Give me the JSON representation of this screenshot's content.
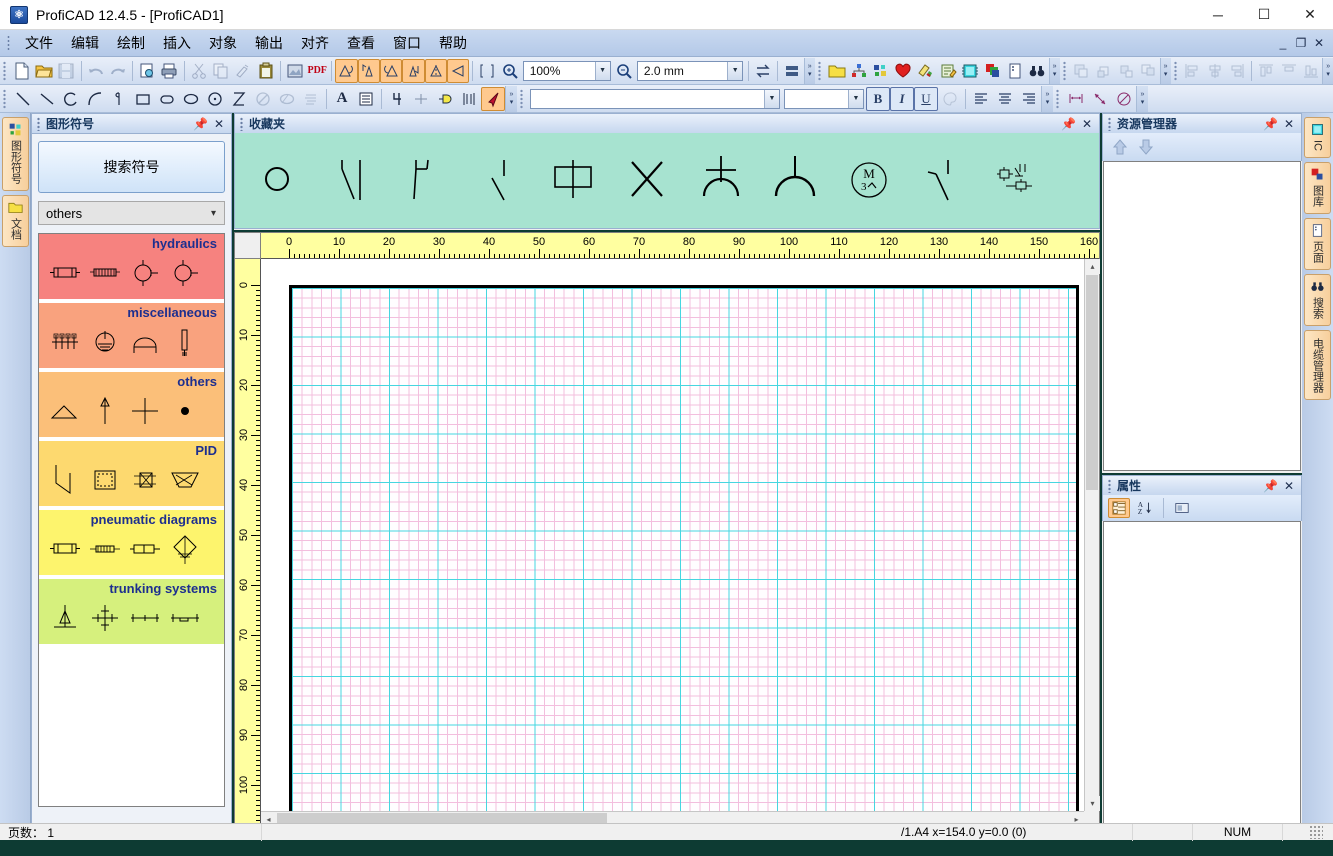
{
  "window": {
    "title": "ProfiCAD 12.4.5 - [ProfiCAD1]",
    "app_icon": "proficad-logo-icon",
    "minimize": "─",
    "maximize": "☐",
    "close": "✕",
    "mdi_minimize": "_",
    "mdi_restore": "❐",
    "mdi_close": "✕"
  },
  "menu": {
    "items": [
      {
        "label": "文件"
      },
      {
        "label": "编辑"
      },
      {
        "label": "绘制"
      },
      {
        "label": "插入"
      },
      {
        "label": "对象"
      },
      {
        "label": "输出"
      },
      {
        "label": "对齐"
      },
      {
        "label": "查看"
      },
      {
        "label": "窗口"
      },
      {
        "label": "帮助"
      }
    ]
  },
  "toolbar_main": {
    "zoom_value": "100%",
    "grid_value": "2.0 mm",
    "pdf_label": "PDF",
    "buttons": [
      {
        "name": "new-file-button",
        "icon": "new-document-icon"
      },
      {
        "name": "open-file-button",
        "icon": "open-folder-icon"
      },
      {
        "name": "save-file-button",
        "icon": "save-disk-icon",
        "disabled": true
      },
      {
        "name": "undo-button",
        "icon": "undo-arrow-icon",
        "disabled": true
      },
      {
        "name": "redo-button",
        "icon": "redo-arrow-icon",
        "disabled": true
      },
      {
        "name": "print-preview-button",
        "icon": "print-preview-icon"
      },
      {
        "name": "print-button",
        "icon": "printer-icon"
      },
      {
        "name": "cut-button",
        "icon": "scissors-icon",
        "disabled": true
      },
      {
        "name": "copy-button",
        "icon": "copy-pages-icon",
        "disabled": true
      },
      {
        "name": "format-painter-button",
        "icon": "brush-icon",
        "disabled": true
      },
      {
        "name": "paste-button",
        "icon": "clipboard-icon"
      },
      {
        "name": "export-image-button",
        "icon": "export-image-icon"
      },
      {
        "name": "export-pdf-button",
        "icon": "pdf-icon"
      },
      {
        "name": "rotate-left-button",
        "icon": "rotate-left-icon"
      },
      {
        "name": "rotate-up-button",
        "icon": "rotate-up-icon"
      },
      {
        "name": "rotate-right-button",
        "icon": "rotate-right-icon"
      },
      {
        "name": "rotate-down-button",
        "icon": "rotate-down-icon"
      },
      {
        "name": "mirror-horizontal-button",
        "icon": "mirror-horizontal-icon"
      },
      {
        "name": "mirror-vertical-button",
        "icon": "mirror-vertical-icon"
      },
      {
        "name": "fit-page-button",
        "icon": "fit-page-icon"
      },
      {
        "name": "zoom-in-button",
        "icon": "magnifier-plus-icon"
      },
      {
        "name": "zoom-out-button",
        "icon": "magnifier-minus-icon"
      },
      {
        "name": "swap-button",
        "icon": "swap-arrows-icon"
      },
      {
        "name": "split-view-button",
        "icon": "split-view-icon"
      }
    ],
    "right_buttons": [
      {
        "name": "library-button",
        "icon": "yellow-folder-icon"
      },
      {
        "name": "hierarchy-button",
        "icon": "network-nodes-icon"
      },
      {
        "name": "netlist-button",
        "icon": "netlist-icon"
      },
      {
        "name": "favorites-button",
        "icon": "red-heart-icon"
      },
      {
        "name": "colors-button",
        "icon": "paint-layers-icon"
      },
      {
        "name": "notes-button",
        "icon": "note-pencil-icon"
      },
      {
        "name": "ic-button",
        "icon": "ic-chip-icon"
      },
      {
        "name": "layers-button",
        "icon": "layers-icon"
      },
      {
        "name": "page-button",
        "icon": "page-icon"
      },
      {
        "name": "find-button",
        "icon": "binoculars-icon"
      }
    ],
    "arrange_buttons": [
      {
        "name": "bring-to-front-button",
        "icon": "bring-to-front-icon"
      },
      {
        "name": "send-to-back-button",
        "icon": "send-to-back-icon"
      },
      {
        "name": "bring-forward-button",
        "icon": "bring-forward-icon"
      },
      {
        "name": "send-backward-button",
        "icon": "send-backward-icon"
      }
    ],
    "align_buttons": [
      {
        "name": "align-left-button",
        "icon": "align-left-icon"
      },
      {
        "name": "align-center-button",
        "icon": "align-center-h-icon"
      },
      {
        "name": "align-right-button",
        "icon": "align-right-icon"
      },
      {
        "name": "align-top-button",
        "icon": "align-top-icon"
      },
      {
        "name": "align-middle-button",
        "icon": "align-middle-v-icon"
      },
      {
        "name": "align-bottom-button",
        "icon": "align-bottom-icon"
      }
    ]
  },
  "toolbar_draw": {
    "font_value": "",
    "font_placeholder": "",
    "size_value": "",
    "bold_label": "B",
    "italic_label": "I",
    "underline_label": "U",
    "buttons": [
      {
        "name": "line-tool-button",
        "icon": "line-icon"
      },
      {
        "name": "polyline-tool-button",
        "icon": "polyline-icon"
      },
      {
        "name": "arc-tool-button",
        "icon": "arc-icon"
      },
      {
        "name": "bezier-tool-button",
        "icon": "bezier-icon"
      },
      {
        "name": "spline-tool-button",
        "icon": "spline-icon"
      },
      {
        "name": "rectangle-tool-button",
        "icon": "rectangle-icon"
      },
      {
        "name": "rounded-rectangle-tool-button",
        "icon": "rounded-rect-icon"
      },
      {
        "name": "ellipse-tool-button",
        "icon": "ellipse-icon"
      },
      {
        "name": "circle-tool-button",
        "icon": "circle-dot-icon"
      },
      {
        "name": "hourglass-tool-button",
        "icon": "hourglass-icon"
      },
      {
        "name": "no-fill-button",
        "icon": "no-fill-icon",
        "disabled": true
      },
      {
        "name": "hidden-button",
        "icon": "hidden-ellipse-icon",
        "disabled": true
      },
      {
        "name": "hatch-button",
        "icon": "hatch-lines-icon",
        "disabled": true
      },
      {
        "name": "text-tool-button",
        "icon": "text-a-icon"
      },
      {
        "name": "textbox-tool-button",
        "icon": "text-box-icon"
      },
      {
        "name": "wire-number-button",
        "icon": "wire-number-icon"
      },
      {
        "name": "junction-button",
        "icon": "junction-cross-icon"
      },
      {
        "name": "terminal-button",
        "icon": "terminal-icon"
      },
      {
        "name": "bus-button",
        "icon": "bus-icon"
      },
      {
        "name": "select-tool-button",
        "icon": "select-arrow-icon",
        "pressed": true
      }
    ],
    "right_buttons": [
      {
        "name": "fill-color-button",
        "icon": "palette-icon",
        "disabled": true
      },
      {
        "name": "text-align-left-button",
        "icon": "text-align-left-icon"
      },
      {
        "name": "text-align-center-button",
        "icon": "text-align-center-icon"
      },
      {
        "name": "text-align-right-button",
        "icon": "text-align-right-icon"
      },
      {
        "name": "dimension-linear-button",
        "icon": "dimension-linear-icon"
      },
      {
        "name": "dimension-arrow-button",
        "icon": "dimension-arrow-icon"
      },
      {
        "name": "dimension-angle-button",
        "icon": "dimension-angle-icon"
      }
    ]
  },
  "left_tabs": [
    {
      "name": "tab-graphic-symbols",
      "label": "图形符号",
      "icon": "symbols-chip-icon"
    },
    {
      "name": "tab-documents",
      "label": "文档",
      "icon": "yellow-folder-icon"
    }
  ],
  "right_tabs": [
    {
      "name": "tab-ic",
      "label": "IC",
      "icon": "ic-chip-icon",
      "latin": true
    },
    {
      "name": "tab-library",
      "label": "图库",
      "icon": "layers-icon"
    },
    {
      "name": "tab-page",
      "label": "页面",
      "icon": "page-icon"
    },
    {
      "name": "tab-search",
      "label": "搜索",
      "icon": "binoculars-icon"
    },
    {
      "name": "tab-cable-manager",
      "label": "电缆管理器",
      "icon": "cable-icon"
    }
  ],
  "symbols_panel": {
    "title": "图形符号",
    "pin_icon": "pin-icon",
    "close_icon": "close-icon",
    "search_button_label": "搜索符号",
    "category_value": "others",
    "groups": [
      {
        "title": "hydraulics",
        "color": "#f6827f",
        "symbols": [
          "hydraulic-cylinder-icon",
          "hydraulic-valve-block-icon",
          "hydraulic-pump-circle-icon",
          "hydraulic-motor-circle-icon"
        ]
      },
      {
        "title": "miscellaneous",
        "color": "#f9a27e",
        "symbols": [
          "terminal-strip-icon",
          "earth-ground-circle-icon",
          "bell-dome-icon",
          "thermometer-probe-icon"
        ]
      },
      {
        "title": "others",
        "color": "#fbbf79",
        "symbols": [
          "angle-triangle-icon",
          "up-arrow-icon",
          "plus-cross-icon",
          "filled-dot-icon"
        ]
      },
      {
        "title": "PID",
        "color": "#fdd96f",
        "symbols": [
          "pid-zigzag-icon",
          "pid-square-tank-icon",
          "pid-valve-grid-icon",
          "pid-hopper-icon"
        ]
      },
      {
        "title": "pneumatic diagrams",
        "color": "#fdf46d",
        "symbols": [
          "pneumatic-cylinder-icon",
          "pneumatic-actuator-icon",
          "pneumatic-single-cylinder-icon",
          "pneumatic-diamond-valve-icon"
        ]
      },
      {
        "title": "trunking systems",
        "color": "#d6f07d",
        "symbols": [
          "trunking-riser-icon",
          "trunking-cross-icon",
          "trunking-straight-icon",
          "trunking-tee-icon"
        ]
      }
    ]
  },
  "favorites_panel": {
    "title": "收藏夹",
    "pin_icon": "pin-icon",
    "close_icon": "close-icon",
    "background": "#a7e3d0",
    "symbols": [
      "circle-lamp-icon",
      "switch-nc-contact-icon",
      "switch-no-contact-icon",
      "switch-break-contact-icon",
      "resistor-box-icon",
      "cross-x-icon",
      "antenna-arc-icon",
      "fork-y-icon",
      "motor-3phase-icon",
      "switch-push-icon",
      "contactor-assembly-icon"
    ]
  },
  "drawing": {
    "ruler_h_labels": [
      "0",
      "10",
      "20",
      "30",
      "40",
      "50",
      "60",
      "70",
      "80",
      "90",
      "100",
      "110",
      "120",
      "130",
      "140",
      "150",
      "160"
    ],
    "ruler_v_labels": [
      "0",
      "10",
      "20",
      "30",
      "40",
      "50",
      "60",
      "70",
      "80",
      "90",
      "100"
    ],
    "ruler_color": "#ffffa0",
    "paper_background": "#fffdff",
    "grid_minor_color": "#f3bede",
    "grid_major_color": "#46d6e0",
    "scroll_up": "▴",
    "scroll_down": "▾",
    "scroll_left": "◂",
    "scroll_right": "▸"
  },
  "resource_panel": {
    "title": "资源管理器",
    "pin_icon": "pin-icon",
    "close_icon": "close-icon",
    "buttons": [
      {
        "name": "move-up-button",
        "icon": "up-arrow-icon"
      },
      {
        "name": "move-down-button",
        "icon": "down-arrow-icon"
      }
    ]
  },
  "properties_panel": {
    "title": "属性",
    "pin_icon": "pin-icon",
    "close_icon": "close-icon",
    "buttons": [
      {
        "name": "categorized-view-button",
        "icon": "categorized-icon",
        "active": true
      },
      {
        "name": "alphabetical-sort-button",
        "icon": "sort-az-icon"
      },
      {
        "name": "property-pages-button",
        "icon": "property-pages-icon"
      }
    ]
  },
  "statusbar": {
    "pages_label": "页数：  1",
    "page_format": "/1.A4  x=154.0  y=0.0 (0)",
    "num_lock": "NUM"
  }
}
